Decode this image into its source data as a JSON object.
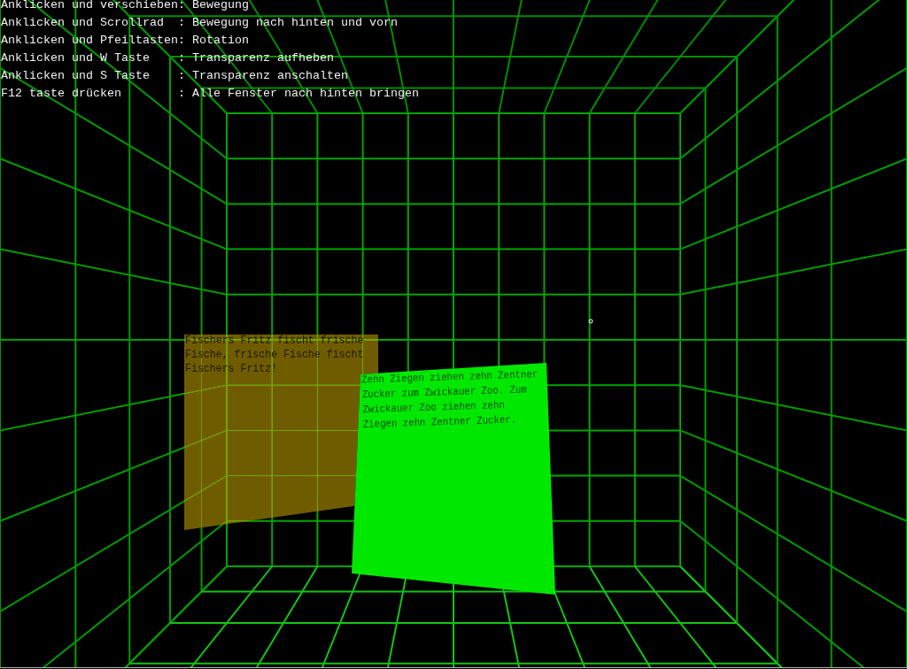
{
  "help_lines": [
    "Anklicken und verschieben: Bewegung",
    "Anklicken und Scrollrad  : Bewegung nach hinten und vorn",
    "Anklicken und Pfeiltasten: Rotation",
    "Anklicken und W Taste    : Transparenz aufheben",
    "Anklicken und S Taste    : Transparenz anschalten",
    "F12 taste drücken        : Alle Fenster nach hinten bringen"
  ],
  "windows": [
    {
      "text": "Fischers Fritz fischt frische Fische, frische Fische fischt Fischers Fritz!",
      "color": "#705c00",
      "transparent": true
    },
    {
      "text": "Zehn Ziegen ziehen zehn Zentner Zucker zum Zwickauer Zoo. Zum Zwickauer Zoo ziehen zehn Ziegen zehn Zentner Zucker.",
      "color": "#00e800",
      "transparent": false
    }
  ]
}
